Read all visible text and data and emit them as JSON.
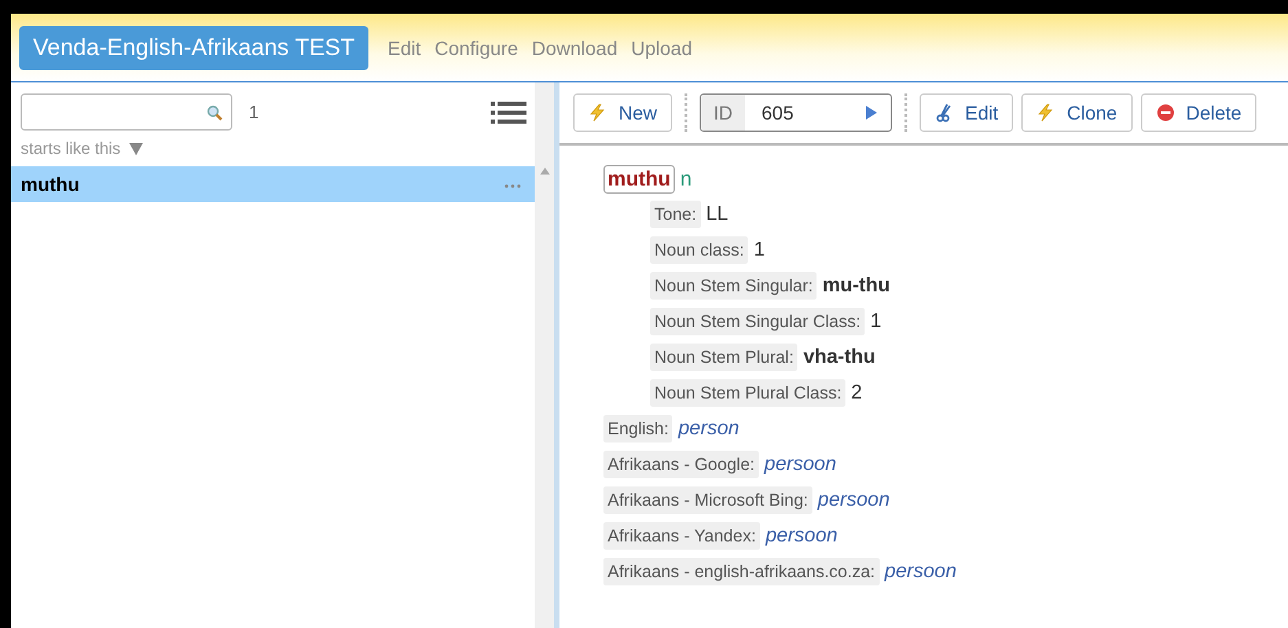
{
  "header": {
    "title": "Venda-English-Afrikaans TEST",
    "menu": [
      "Edit",
      "Configure",
      "Download",
      "Upload"
    ]
  },
  "sidebar": {
    "count": "1",
    "filter": "starts like this",
    "entries": [
      {
        "label": "muthu",
        "selected": true
      }
    ]
  },
  "toolbar": {
    "new": "New",
    "id_field": {
      "label": "ID",
      "value": "605"
    },
    "actions": [
      {
        "kind": "edit",
        "label": "Edit"
      },
      {
        "kind": "clone",
        "label": "Clone"
      },
      {
        "kind": "delete",
        "label": "Delete"
      }
    ]
  },
  "entry": {
    "headword": "muthu",
    "pos": "n",
    "children": [
      {
        "label": "Tone:",
        "value": "LL",
        "kind": "plain"
      },
      {
        "label": "Noun class:",
        "value": "1",
        "kind": "plain"
      },
      {
        "label": "Noun Stem Singular:",
        "value": "mu-thu",
        "kind": "bold"
      },
      {
        "label": "Noun Stem Singular Class:",
        "value": "1",
        "kind": "plain"
      },
      {
        "label": "Noun Stem Plural:",
        "value": "vha-thu",
        "kind": "bold"
      },
      {
        "label": "Noun Stem Plural Class:",
        "value": "2",
        "kind": "plain"
      }
    ],
    "translations": [
      {
        "label": "English:",
        "value": "person",
        "kind": "translation"
      },
      {
        "label": "Afrikaans - Google:",
        "value": "persoon",
        "kind": "translation"
      },
      {
        "label": "Afrikaans - Microsoft Bing:",
        "value": "persoon",
        "kind": "translation"
      },
      {
        "label": "Afrikaans - Yandex:",
        "value": "persoon",
        "kind": "translation"
      },
      {
        "label": "Afrikaans - english-afrikaans.co.za:",
        "value": "persoon",
        "kind": "translation"
      }
    ]
  }
}
